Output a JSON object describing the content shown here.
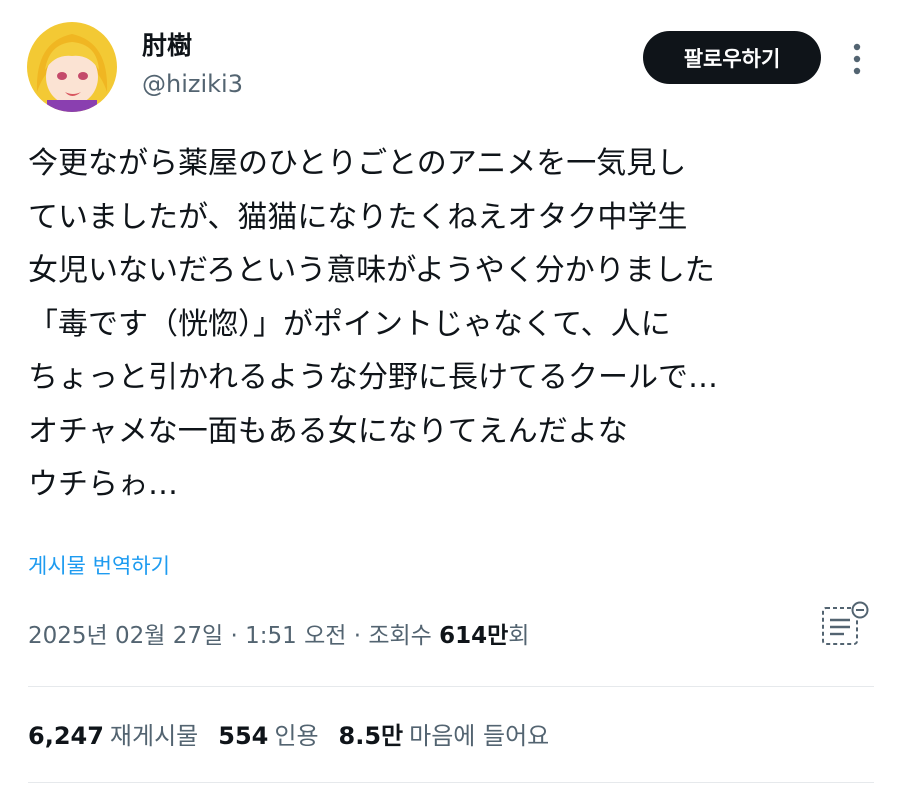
{
  "author": {
    "name": "肘樹",
    "handle": "@hiziki3"
  },
  "follow_label": "팔로우하기",
  "tweet": {
    "lines": [
      "今更ながら薬屋のひとりごとのアニメを一気見し",
      "ていましたが、猫猫になりたくねえオタク中学生",
      "女児いないだろという意味がようやく分かりました",
      "「毒です（恍惚）」がポイントじゃなくて、人に",
      "ちょっと引かれるような分野に長けてるクールで…",
      "オチャメな一面もある女になりてえんだよな",
      "ウチらゎ…"
    ]
  },
  "translate_label": "게시물 번역하기",
  "meta": {
    "date": "2025년 02월 27일",
    "sep1": " · ",
    "time": "1:51 오전",
    "sep2": " · ",
    "views_label": "조회수 ",
    "views_num": "614만",
    "views_unit": "회"
  },
  "stats": {
    "reposts_num": "6,247",
    "reposts_label": "재게시물",
    "quotes_num": "554",
    "quotes_label": "인용",
    "likes_num": "8.5만",
    "likes_label": "마음에 들어요"
  },
  "icons": {
    "more": "more-vertical-icon",
    "analytics": "analytics-icon"
  },
  "colors": {
    "link": "#1d9bf0",
    "muted": "#536471",
    "button_bg": "#0f1419",
    "avatar_bg": "#f5d13a"
  }
}
